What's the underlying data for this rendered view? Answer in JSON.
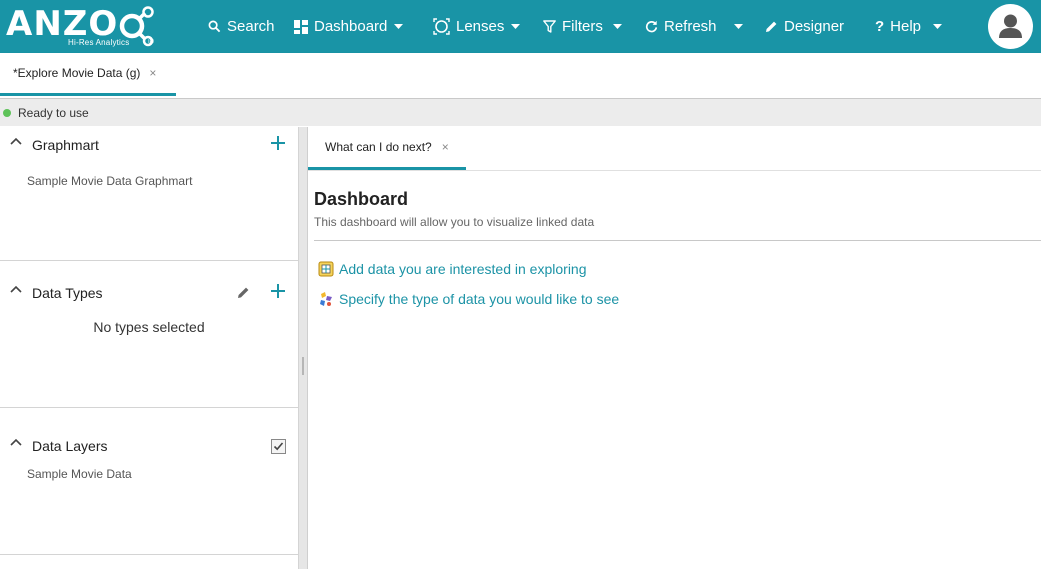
{
  "brand": {
    "name": "ANZO",
    "tagline": "Hi-Res Analytics",
    "registered": "®",
    "color": "#1994a6"
  },
  "nav": {
    "search": "Search",
    "dashboard": "Dashboard",
    "lenses": "Lenses",
    "filters": "Filters",
    "refresh": "Refresh",
    "designer": "Designer",
    "help": "Help"
  },
  "tabs": {
    "main_label": "*Explore Movie Data (g)",
    "close": "×"
  },
  "status": {
    "text": "Ready to use",
    "color": "#5dc258"
  },
  "left": {
    "graphmart": {
      "title": "Graphmart",
      "item": "Sample Movie Data Graphmart"
    },
    "data_types": {
      "title": "Data Types",
      "empty": "No types selected"
    },
    "data_layers": {
      "title": "Data Layers",
      "item": "Sample Movie Data"
    }
  },
  "content": {
    "subtab_label": "What can I do next?",
    "subtab_close": "×",
    "title": "Dashboard",
    "description": "This dashboard will allow you to visualize linked data",
    "actions": [
      {
        "label": "Add data you are interested in exploring",
        "icon": "add-data-icon"
      },
      {
        "label": "Specify the type of data you would like to see",
        "icon": "specify-type-icon"
      }
    ]
  }
}
